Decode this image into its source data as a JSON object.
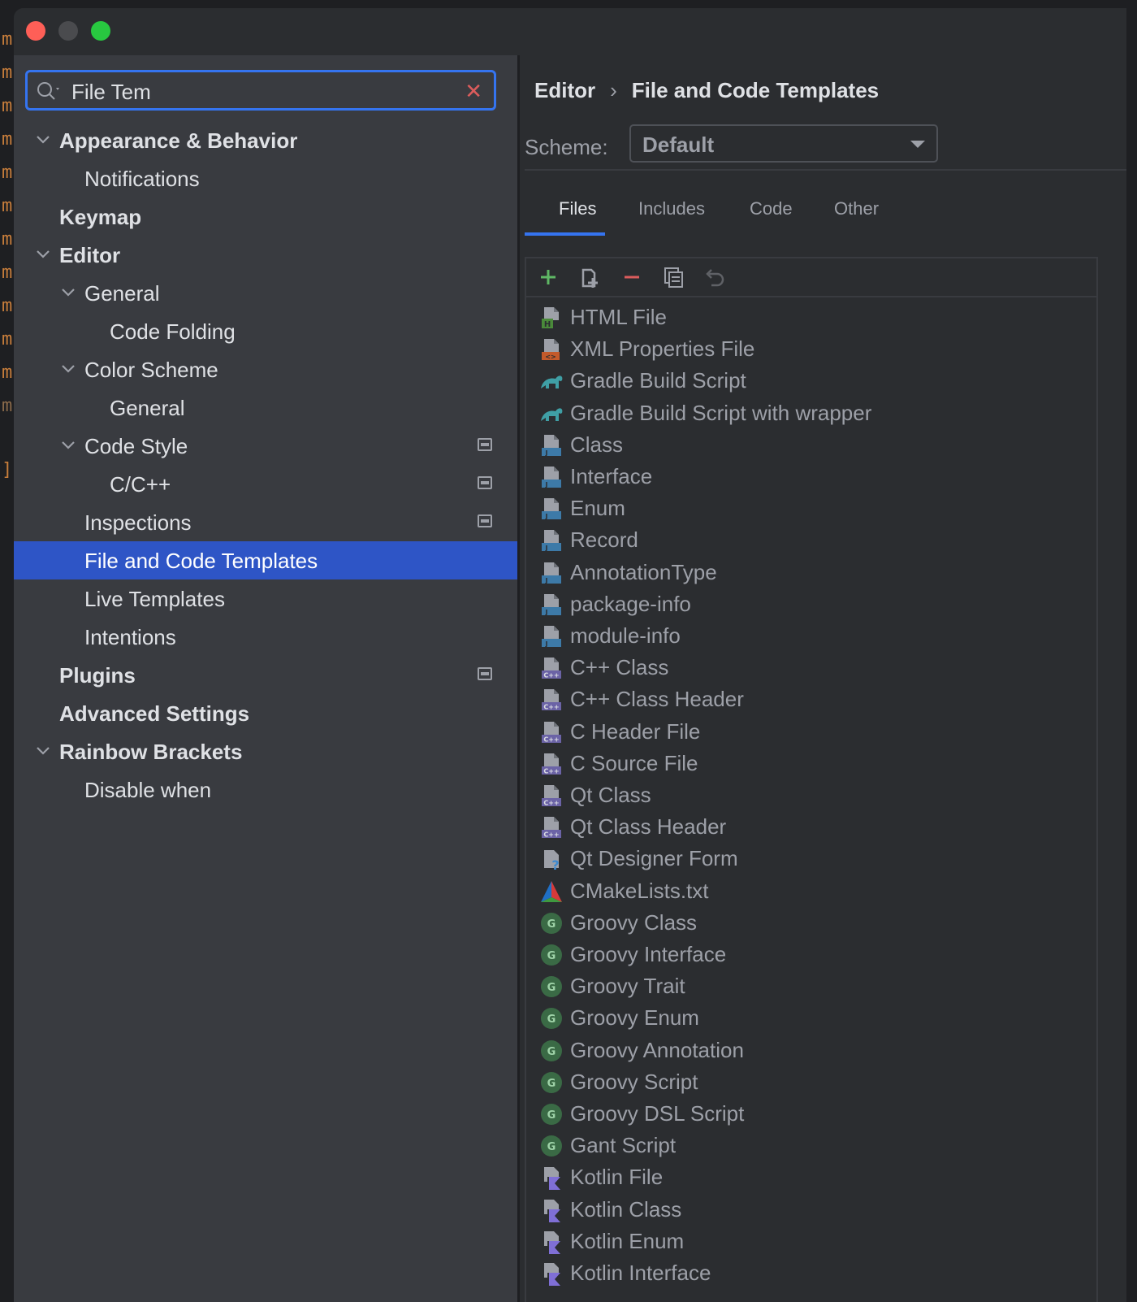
{
  "search": {
    "value": "File Tem"
  },
  "sidebar": {
    "items": [
      {
        "label": "Appearance & Behavior",
        "level": 0,
        "bold": true,
        "expanded": true
      },
      {
        "label": "Notifications",
        "level": 1,
        "bold": false
      },
      {
        "label": "Keymap",
        "level": 0,
        "bold": true
      },
      {
        "label": "Editor",
        "level": 0,
        "bold": true,
        "expanded": true
      },
      {
        "label": "General",
        "level": 1,
        "bold": false,
        "expanded": true
      },
      {
        "label": "Code Folding",
        "level": 2,
        "bold": false
      },
      {
        "label": "Color Scheme",
        "level": 1,
        "bold": false,
        "expanded": true
      },
      {
        "label": "General",
        "level": 2,
        "bold": false
      },
      {
        "label": "Code Style",
        "level": 1,
        "bold": false,
        "expanded": true,
        "project_icon": true
      },
      {
        "label": "C/C++",
        "level": 2,
        "bold": false,
        "project_icon": true
      },
      {
        "label": "Inspections",
        "level": 1,
        "bold": false,
        "project_icon": true
      },
      {
        "label": "File and Code Templates",
        "level": 1,
        "bold": false,
        "selected": true
      },
      {
        "label": "Live Templates",
        "level": 1,
        "bold": false
      },
      {
        "label": "Intentions",
        "level": 1,
        "bold": false
      },
      {
        "label": "Plugins",
        "level": 0,
        "bold": true,
        "project_icon": true
      },
      {
        "label": "Advanced Settings",
        "level": 0,
        "bold": true
      },
      {
        "label": "Rainbow Brackets",
        "level": 0,
        "bold": true,
        "expanded": true
      },
      {
        "label": "Disable when",
        "level": 1,
        "bold": false
      }
    ]
  },
  "breadcrumb": {
    "parent": "Editor",
    "separator": "›",
    "current": "File and Code Templates"
  },
  "scheme": {
    "label": "Scheme:",
    "value": "Default"
  },
  "tabs": [
    {
      "label": "Files",
      "active": true
    },
    {
      "label": "Includes",
      "active": false
    },
    {
      "label": "Code",
      "active": false
    },
    {
      "label": "Other",
      "active": false
    }
  ],
  "toolbar": [
    "add-icon",
    "add-child-icon",
    "remove-icon",
    "copy-icon",
    "reset-icon"
  ],
  "templates": [
    {
      "label": "HTML File",
      "icon": "html"
    },
    {
      "label": "XML Properties File",
      "icon": "xml"
    },
    {
      "label": "Gradle Build Script",
      "icon": "gradle"
    },
    {
      "label": "Gradle Build Script with wrapper",
      "icon": "gradle"
    },
    {
      "label": "Class",
      "icon": "java"
    },
    {
      "label": "Interface",
      "icon": "java"
    },
    {
      "label": "Enum",
      "icon": "java"
    },
    {
      "label": "Record",
      "icon": "java"
    },
    {
      "label": "AnnotationType",
      "icon": "java"
    },
    {
      "label": "package-info",
      "icon": "java"
    },
    {
      "label": "module-info",
      "icon": "java"
    },
    {
      "label": "C++ Class",
      "icon": "cpp"
    },
    {
      "label": "C++ Class Header",
      "icon": "cpp"
    },
    {
      "label": "C Header File",
      "icon": "cpp"
    },
    {
      "label": "C Source File",
      "icon": "cpp"
    },
    {
      "label": "Qt Class",
      "icon": "cpp"
    },
    {
      "label": "Qt Class Header",
      "icon": "cpp"
    },
    {
      "label": "Qt Designer Form",
      "icon": "unknown"
    },
    {
      "label": "CMakeLists.txt",
      "icon": "cmake"
    },
    {
      "label": "Groovy Class",
      "icon": "groovy"
    },
    {
      "label": "Groovy Interface",
      "icon": "groovy"
    },
    {
      "label": "Groovy Trait",
      "icon": "groovy"
    },
    {
      "label": "Groovy Enum",
      "icon": "groovy"
    },
    {
      "label": "Groovy Annotation",
      "icon": "groovy"
    },
    {
      "label": "Groovy Script",
      "icon": "groovy"
    },
    {
      "label": "Groovy DSL Script",
      "icon": "groovy"
    },
    {
      "label": "Gant Script",
      "icon": "groovy"
    },
    {
      "label": "Kotlin File",
      "icon": "kotlin"
    },
    {
      "label": "Kotlin Class",
      "icon": "kotlin"
    },
    {
      "label": "Kotlin Enum",
      "icon": "kotlin"
    },
    {
      "label": "Kotlin Interface",
      "icon": "kotlin"
    }
  ],
  "colors": {
    "accent": "#3574f0",
    "selection": "#2e55c6",
    "sidebar_bg": "#393b40",
    "main_bg": "#2b2d30",
    "text": "#dfe1e5",
    "text_muted": "#9da0a8",
    "add_green": "#5fb865",
    "remove_red": "#db5c5c"
  }
}
